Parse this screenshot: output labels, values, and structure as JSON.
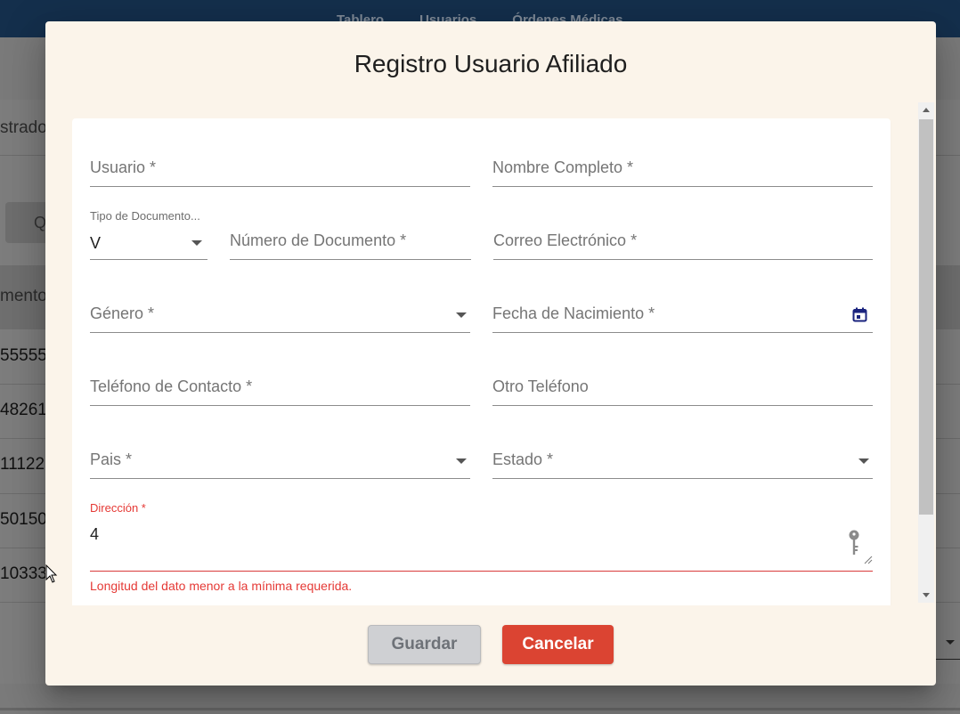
{
  "background": {
    "nav": [
      "Tablero",
      "Usuarios",
      "Órdenes Médicas"
    ],
    "registrado_label": "strado",
    "table_header_fragment": "mento",
    "rows": [
      "55555",
      "48261",
      "11122",
      "50150",
      "10333"
    ],
    "search_fragment": "Q"
  },
  "dialog": {
    "title": "Registro Usuario Afiliado",
    "fields": {
      "usuario": "Usuario *",
      "nombre": "Nombre Completo *",
      "tipo_doc_label": "Tipo de Documento...",
      "tipo_doc_value": "V",
      "numero_doc": "Número de Documento *",
      "correo": "Correo Electrónico *",
      "genero": "Género *",
      "fecha_nac": "Fecha de Nacimiento *",
      "telefono": "Teléfono de Contacto *",
      "otro_telefono": "Otro Teléfono",
      "pais": "Pais *",
      "estado": "Estado *",
      "direccion_label": "Dirección *",
      "direccion_value": "4",
      "direccion_error": "Longitud del dato menor a la mínima requerida."
    },
    "buttons": {
      "save": "Guardar",
      "cancel": "Cancelar"
    }
  },
  "colors": {
    "dialog_bg": "#fbf4ea",
    "error": "#e53935",
    "cancel_button": "#db4432",
    "save_button": "#cfd0d3",
    "topbar": "#142f4c",
    "calendar_icon": "#1a237e"
  },
  "icons": [
    "calendar-icon",
    "key-icon",
    "dropdown-arrow-icon",
    "resize-handle-icon",
    "mouse-cursor-icon"
  ]
}
